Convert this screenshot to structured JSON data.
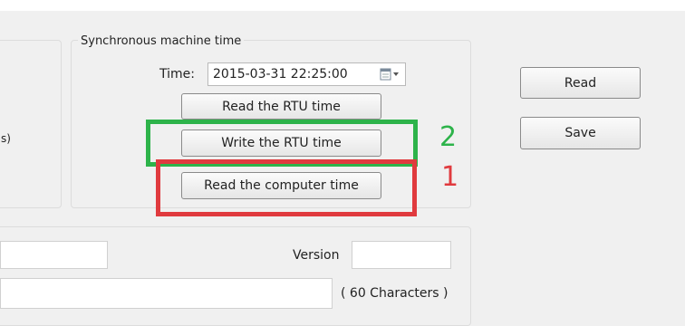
{
  "sync_group": {
    "title": "Synchronous machine time",
    "time_label": "Time:",
    "time_value": "2015-03-31 22:25:00",
    "buttons": {
      "read_rtu": "Read the RTU time",
      "write_rtu": "Write the RTU time",
      "read_computer": "Read the computer time"
    }
  },
  "left_group": {
    "partial_text": "s)"
  },
  "actions": {
    "read": "Read",
    "save": "Save"
  },
  "bottom_group": {
    "version_label": "Version",
    "char_limit": "( 60 Characters )"
  },
  "annotations": {
    "green": {
      "number": "2",
      "color": "#2db34a"
    },
    "red": {
      "number": "1",
      "color": "#e03a3e"
    }
  }
}
